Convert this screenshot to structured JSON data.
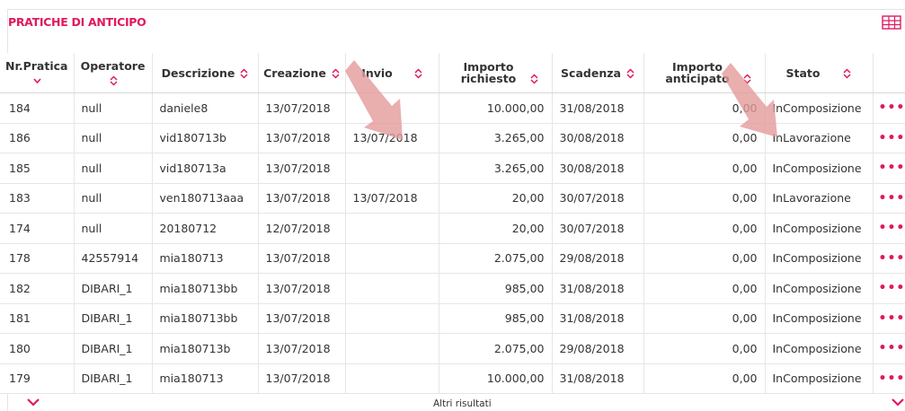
{
  "panel": {
    "title": "PRATICHE DI ANTICIPO"
  },
  "table": {
    "headers": [
      {
        "label": "Nr.Pratica"
      },
      {
        "label": "Operatore"
      },
      {
        "label": "Descrizione"
      },
      {
        "label": "Creazione"
      },
      {
        "label": "Invio"
      },
      {
        "label": "Importo richiesto"
      },
      {
        "label": "Scadenza"
      },
      {
        "label": "Importo anticipato"
      },
      {
        "label": "Stato"
      }
    ],
    "rows": [
      {
        "nr": "184",
        "operatore": "null",
        "descrizione": "daniele8",
        "creazione": "13/07/2018",
        "invio": "",
        "richiesto": "10.000,00",
        "scadenza": "31/08/2018",
        "anticipato": "0,00",
        "stato": "InComposizione",
        "actions": "•••"
      },
      {
        "nr": "186",
        "operatore": "null",
        "descrizione": "vid180713b",
        "creazione": "13/07/2018",
        "invio": "13/07/2018",
        "richiesto": "3.265,00",
        "scadenza": "30/08/2018",
        "anticipato": "0,00",
        "stato": "InLavorazione",
        "actions": "•••"
      },
      {
        "nr": "185",
        "operatore": "null",
        "descrizione": "vid180713a",
        "creazione": "13/07/2018",
        "invio": "",
        "richiesto": "3.265,00",
        "scadenza": "30/08/2018",
        "anticipato": "0,00",
        "stato": "InComposizione",
        "actions": "•••"
      },
      {
        "nr": "183",
        "operatore": "null",
        "descrizione": "ven180713aaa",
        "creazione": "13/07/2018",
        "invio": "13/07/2018",
        "richiesto": "20,00",
        "scadenza": "30/07/2018",
        "anticipato": "0,00",
        "stato": "InLavorazione",
        "actions": "•••"
      },
      {
        "nr": "174",
        "operatore": "null",
        "descrizione": "20180712",
        "creazione": "12/07/2018",
        "invio": "",
        "richiesto": "20,00",
        "scadenza": "30/07/2018",
        "anticipato": "0,00",
        "stato": "InComposizione",
        "actions": "•••"
      },
      {
        "nr": "178",
        "operatore": "42557914",
        "descrizione": "mia180713",
        "creazione": "13/07/2018",
        "invio": "",
        "richiesto": "2.075,00",
        "scadenza": "29/08/2018",
        "anticipato": "0,00",
        "stato": "InComposizione",
        "actions": "•••"
      },
      {
        "nr": "182",
        "operatore": "DIBARI_1",
        "descrizione": "mia180713bb",
        "creazione": "13/07/2018",
        "invio": "",
        "richiesto": "985,00",
        "scadenza": "31/08/2018",
        "anticipato": "0,00",
        "stato": "InComposizione",
        "actions": "•••"
      },
      {
        "nr": "181",
        "operatore": "DIBARI_1",
        "descrizione": "mia180713bb",
        "creazione": "13/07/2018",
        "invio": "",
        "richiesto": "985,00",
        "scadenza": "31/08/2018",
        "anticipato": "0,00",
        "stato": "InComposizione",
        "actions": "•••"
      },
      {
        "nr": "180",
        "operatore": "DIBARI_1",
        "descrizione": "mia180713b",
        "creazione": "13/07/2018",
        "invio": "",
        "richiesto": "2.075,00",
        "scadenza": "29/08/2018",
        "anticipato": "0,00",
        "stato": "InComposizione",
        "actions": "•••"
      },
      {
        "nr": "179",
        "operatore": "DIBARI_1",
        "descrizione": "mia180713",
        "creazione": "13/07/2018",
        "invio": "",
        "richiesto": "10.000,00",
        "scadenza": "31/08/2018",
        "anticipato": "0,00",
        "stato": "InComposizione",
        "actions": "•••"
      }
    ]
  },
  "footer": {
    "more_results": "Altri risultati"
  },
  "icons": {
    "table_view": "table-grid-icon",
    "sort": "sort-arrows-icon",
    "sort_active": "sort-descending-icon",
    "actions": "more-dots-icon",
    "collapse": "chevron-down-icon",
    "annotation": "arrow-annotation-icon"
  },
  "colors": {
    "accent": "#e0195f",
    "annotation": "#e6a0a0"
  }
}
